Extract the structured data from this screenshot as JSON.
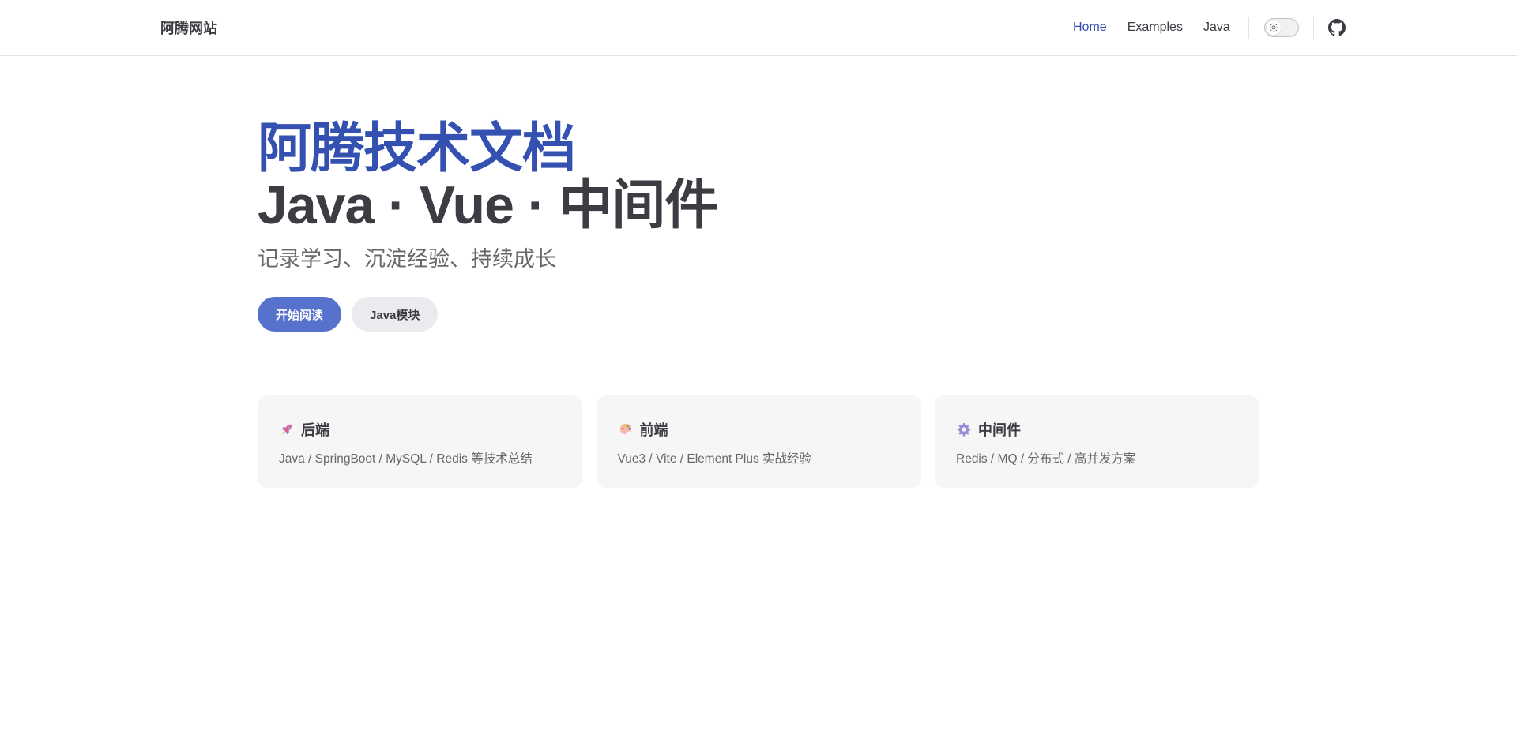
{
  "navbar": {
    "brand": "阿腾网站",
    "links": [
      {
        "label": "Home",
        "active": true
      },
      {
        "label": "Examples",
        "active": false
      },
      {
        "label": "Java",
        "active": false
      }
    ],
    "theme_toggle_icon": "sun-icon",
    "social_icon": "github-icon"
  },
  "hero": {
    "name": "阿腾技术文档",
    "text": "Java · Vue · 中间件",
    "tagline": "记录学习、沉淀经验、持续成长",
    "actions": [
      {
        "label": "开始阅读",
        "theme": "brand"
      },
      {
        "label": "Java模块",
        "theme": "alt"
      }
    ]
  },
  "features": [
    {
      "icon": "rocket-icon",
      "title": "后端",
      "details": "Java / SpringBoot / MySQL / Redis 等技术总结"
    },
    {
      "icon": "palette-icon",
      "title": "前端",
      "details": "Vue3 / Vite / Element Plus 实战经验"
    },
    {
      "icon": "gear-icon",
      "title": "中间件",
      "details": "Redis / MQ / 分布式 / 高并发方案"
    }
  ],
  "colors": {
    "brand": "#3451b2",
    "button_brand": "#5672cd",
    "text": "#3c3c43",
    "muted": "#67676c",
    "card_bg": "#f6f6f7"
  }
}
